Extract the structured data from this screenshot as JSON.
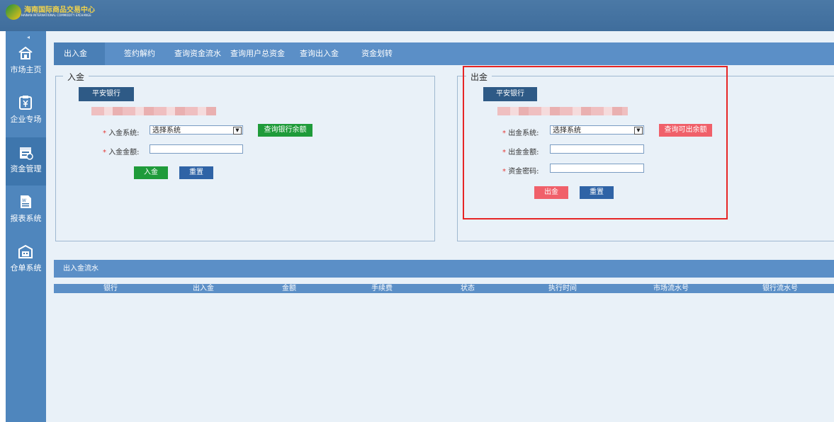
{
  "header": {
    "logo_cn": "海南国际商品交易中心",
    "logo_en": "HAINAN INTERNATIONAL COMMODITY EXCHANGE"
  },
  "sidebar": {
    "collapse": "◂",
    "items": [
      {
        "label": "市场主页",
        "icon": "home-icon"
      },
      {
        "label": "企业专场",
        "icon": "yuan-clipboard-icon"
      },
      {
        "label": "资金管理",
        "icon": "calendar-fund-icon"
      },
      {
        "label": "报表系统",
        "icon": "word-document-icon"
      },
      {
        "label": "仓单系统",
        "icon": "warehouse-icon"
      }
    ]
  },
  "tabs": [
    "出入金",
    "签约解约",
    "查询资金流水",
    "查询用户总资金",
    "查询出入金",
    "资金划转"
  ],
  "deposit": {
    "legend": "入金",
    "bank_button": "平安银行",
    "system_label": "入金系统:",
    "system_value": "选择系统",
    "query_button": "查询银行余额",
    "amount_label": "入金金额:",
    "submit_button": "入金",
    "reset_button": "重置"
  },
  "withdraw": {
    "legend": "出金",
    "bank_button": "平安银行",
    "system_label": "出金系统:",
    "system_value": "选择系统",
    "query_button": "查询可出余额",
    "amount_label": "出金金额:",
    "password_label": "资金密码:",
    "submit_button": "出金",
    "reset_button": "重置"
  },
  "flow": {
    "title": "出入金流水",
    "columns": [
      "银行",
      "出入金",
      "金额",
      "手续费",
      "状态",
      "执行时间",
      "市场流水号",
      "银行流水号"
    ]
  },
  "colors": {
    "header": "#4b79a6",
    "sidebar": "#4f86bd",
    "tabbar": "#5b8fc7",
    "green": "#1f9b3a",
    "red": "#f0606a",
    "highlight": "#e62525"
  }
}
